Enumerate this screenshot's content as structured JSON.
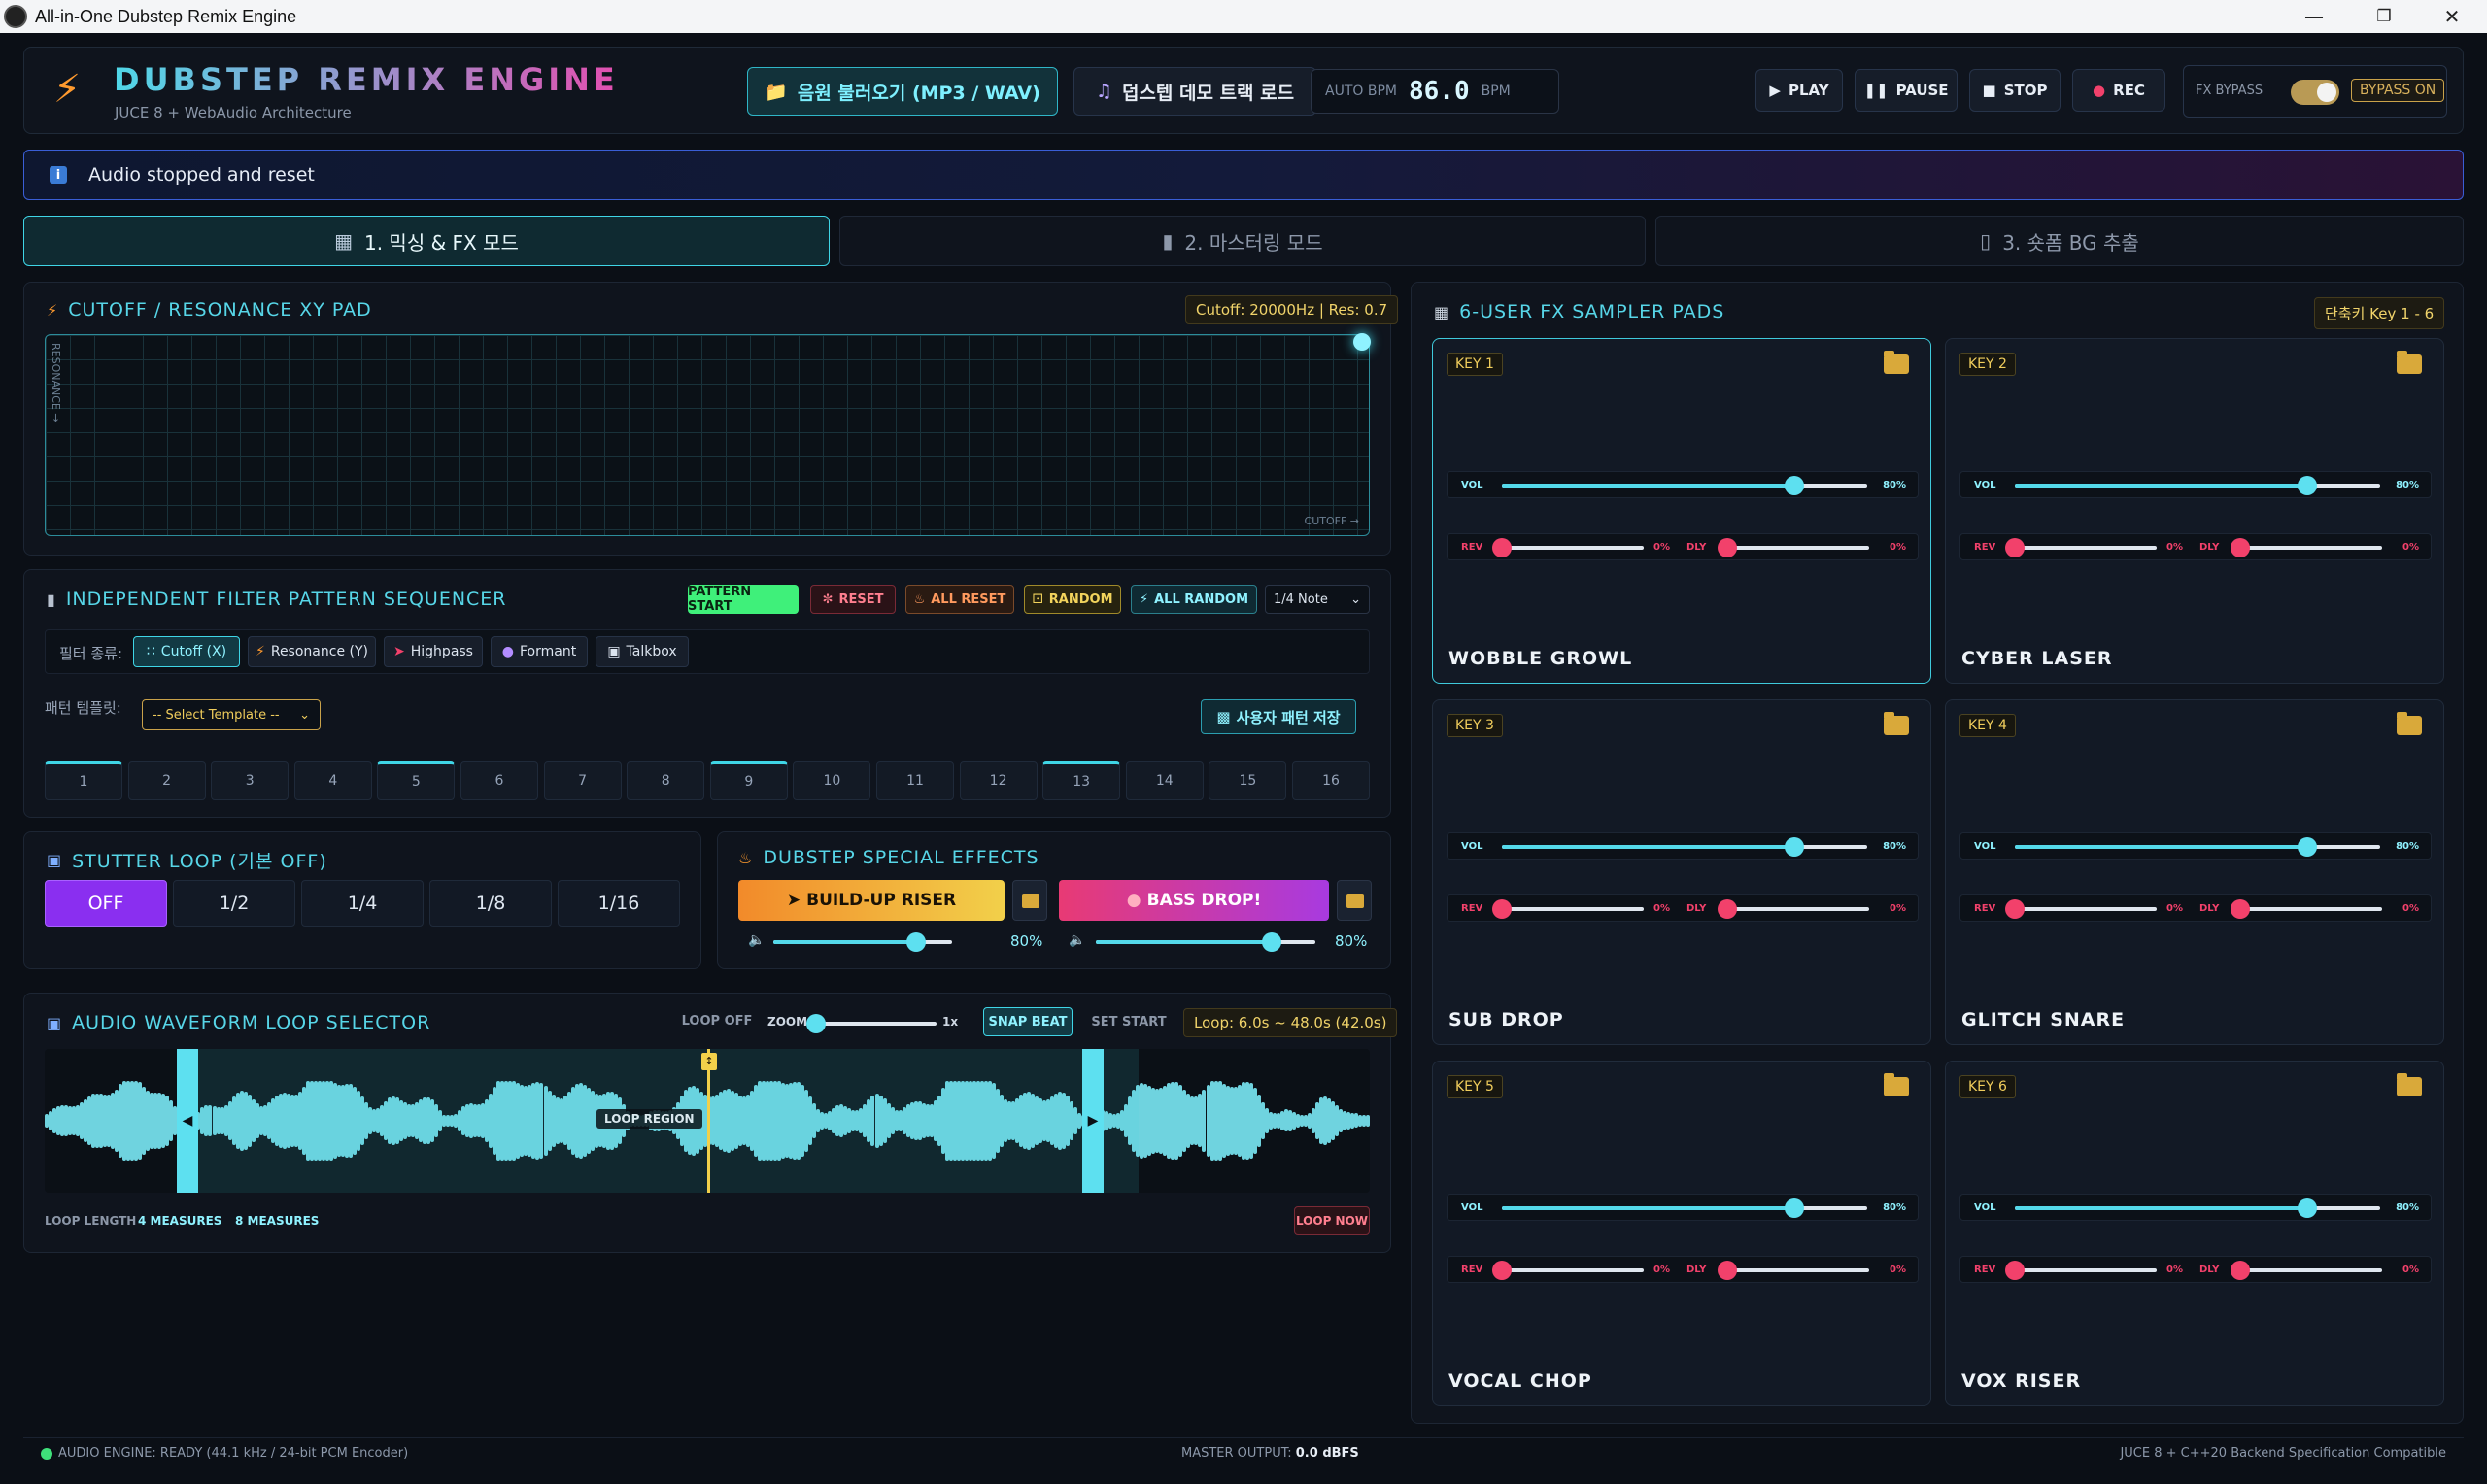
{
  "window": {
    "title": "All-in-One Dubstep Remix Engine"
  },
  "header": {
    "brand": "DUBSTEP REMIX ENGINE",
    "subtitle": "JUCE 8 + WebAudio Architecture",
    "load_audio": "음원 불러오기 (MP3 / WAV)",
    "load_demo": "덥스텝 데모 트랙 로드",
    "bpm_label": "AUTO BPM",
    "bpm_value": "86.0",
    "bpm_unit": "BPM",
    "play": "PLAY",
    "pause": "PAUSE",
    "stop": "STOP",
    "rec": "REC",
    "fx_bypass_label": "FX BYPASS",
    "bypass_state": "BYPASS ON"
  },
  "status": {
    "message": "Audio stopped and reset"
  },
  "tabs": [
    {
      "label": "1. 믹싱 & FX 모드"
    },
    {
      "label": "2. 마스터링 모드"
    },
    {
      "label": "3. 숏폼 BG 추출"
    }
  ],
  "xy": {
    "title": "CUTOFF / RESONANCE XY PAD",
    "readout": "Cutoff: 20000Hz | Res: 0.7",
    "y_axis": "RESONANCE →",
    "x_axis": "CUTOFF →"
  },
  "seq": {
    "title": "INDEPENDENT FILTER PATTERN SEQUENCER",
    "pattern_start": "PATTERN START",
    "reset": "RESET",
    "all_reset": "ALL RESET",
    "random": "RANDOM",
    "all_random": "ALL RANDOM",
    "note": "1/4 Note",
    "filter_label": "필터 종류:",
    "filters": [
      "Cutoff (X)",
      "Resonance (Y)",
      "Highpass",
      "Formant",
      "Talkbox"
    ],
    "template_label": "패턴 템플릿:",
    "template_select": "-- Select Template --",
    "save_pattern": "사용자 패턴 저장",
    "steps": [
      "1",
      "2",
      "3",
      "4",
      "5",
      "6",
      "7",
      "8",
      "9",
      "10",
      "11",
      "12",
      "13",
      "14",
      "15",
      "16"
    ]
  },
  "stutter": {
    "title": "STUTTER LOOP (기본 OFF)",
    "options": [
      "OFF",
      "1/2",
      "1/4",
      "1/8",
      "1/16"
    ]
  },
  "special": {
    "title": "DUBSTEP SPECIAL EFFECTS",
    "buildup": "BUILD-UP RISER",
    "bassdrop": "BASS DROP!",
    "buildup_vol": "80%",
    "bassdrop_vol": "80%",
    "buildup_level": 0.8,
    "bassdrop_level": 0.8
  },
  "wave": {
    "title": "AUDIO WAVEFORM LOOP SELECTOR",
    "loop_off": "LOOP OFF",
    "zoom_label": "ZOOM",
    "zoom_value": "1x",
    "snap": "SNAP BEAT",
    "set_start": "SET START",
    "loop_info": "Loop: 6.0s ~ 48.0s (42.0s)",
    "region_label": "LOOP REGION",
    "loop_length": "LOOP LENGTH",
    "m4": "4 MEASURES",
    "m8": "8 MEASURES",
    "loop_now": "LOOP NOW"
  },
  "pads": {
    "title": "6-USER FX SAMPLER PADS",
    "shortcut": "단축키 Key 1 - 6",
    "vol_label": "VOL",
    "rev_label": "REV",
    "dly_label": "DLY",
    "items": [
      {
        "key": "KEY 1",
        "name": "WOBBLE GROWL",
        "vol": "80%",
        "rev": "0%",
        "dly": "0%",
        "vol_level": 0.8
      },
      {
        "key": "KEY 2",
        "name": "CYBER LASER",
        "vol": "80%",
        "rev": "0%",
        "dly": "0%",
        "vol_level": 0.8
      },
      {
        "key": "KEY 3",
        "name": "SUB DROP",
        "vol": "80%",
        "rev": "0%",
        "dly": "0%",
        "vol_level": 0.8
      },
      {
        "key": "KEY 4",
        "name": "GLITCH SNARE",
        "vol": "80%",
        "rev": "0%",
        "dly": "0%",
        "vol_level": 0.8
      },
      {
        "key": "KEY 5",
        "name": "VOCAL CHOP",
        "vol": "80%",
        "rev": "0%",
        "dly": "0%",
        "vol_level": 0.8
      },
      {
        "key": "KEY 6",
        "name": "VOX RISER",
        "vol": "80%",
        "rev": "0%",
        "dly": "0%",
        "vol_level": 0.8
      }
    ]
  },
  "footer": {
    "engine": "AUDIO ENGINE: READY (44.1 kHz / 24-bit PCM Encoder)",
    "master_label": "MASTER OUTPUT:",
    "master_value": "0.0 dBFS",
    "compat": "JUCE 8 + C++20 Backend Specification Compatible"
  },
  "colors": {
    "accent": "#3fd5e6",
    "magenta": "#e24fb0",
    "orange": "#ff9a2e",
    "red": "#f2416b",
    "purple": "#8a2ff0"
  }
}
